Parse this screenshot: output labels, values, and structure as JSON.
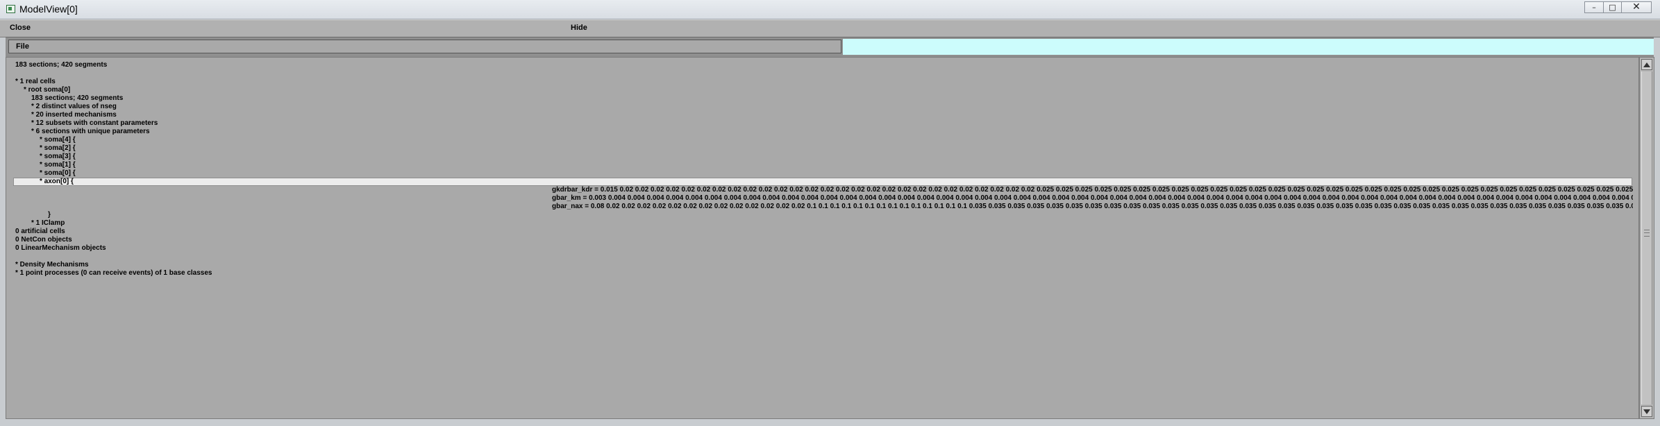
{
  "window": {
    "title": "ModelView[0]",
    "controls": {
      "minimize": "–",
      "maximize": "□",
      "close": "✕"
    }
  },
  "menubar": {
    "close_label": "Close",
    "hide_label": "Hide"
  },
  "filebar": {
    "file_label": "File"
  },
  "tree": {
    "summary": "183 sections; 420 segments",
    "real_cells": "* 1 real cells",
    "root": "* root soma[0]",
    "root_summary": "183 sections; 420 segments",
    "nseg": "* 2 distinct values of nseg",
    "mechanisms": "* 20 inserted mechanisms",
    "subsets": "* 12 subsets with constant parameters",
    "unique_sections": "* 6 sections with unique parameters",
    "sections": [
      "* soma[4] {",
      "* soma[2] {",
      "* soma[3] {",
      "* soma[1] {",
      "* soma[0] {",
      "* axon[0] {"
    ],
    "params": [
      "gkdrbar_kdr = 0.015 0.02 0.02 0.02 0.02 0.02 0.02 0.02 0.02 0.02 0.02 0.02 0.02 0.02 0.02 0.02 0.02 0.02 0.02 0.02 0.02 0.02 0.02 0.02 0.02 0.02 0.02 0.02 0.025 0.025 0.025 0.025 0.025 0.025 0.025 0.025 0.025 0.025 0.025 0.025 0.025 0.025 0.025 0.025 0.025 0.025 0.025 0.025 0.025 0.025 0.025 0.025 0.025 0.025 0.025 0.025 0.025 0.025 0.025 0.025 0.025 0.025 0.025 0.025 0.025 0.025 0",
      "gbar_km = 0.003 0.004 0.004 0.004 0.004 0.004 0.004 0.004 0.004 0.004 0.004 0.004 0.004 0.004 0.004 0.004 0.004 0.004 0.004 0.004 0.004 0.004 0.004 0.004 0.004 0.004 0.004 0.004 0.004 0.004 0.004 0.004 0.004 0.004 0.004 0.004 0.004 0.004 0.004 0.004 0.004 0.004 0.004 0.004 0.004 0.004 0.004 0.004 0.004 0.004 0.004 0.004 0.004 0.004 0.004 0.004 0.004 0.004 0.004 0.004 0.004 0.004 0.004 0.004 0.004 0.004 0.004 0",
      "gbar_nax = 0.08 0.02 0.02 0.02 0.02 0.02 0.02 0.02 0.02 0.02 0.02 0.02 0.02 0.02 0.1 0.1 0.1 0.1 0.1 0.1 0.1 0.1 0.1 0.1 0.1 0.1 0.1 0.1 0.035 0.035 0.035 0.035 0.035 0.035 0.035 0.035 0.035 0.035 0.035 0.035 0.035 0.035 0.035 0.035 0.035 0.035 0.035 0.035 0.035 0.035 0.035 0.035 0.035 0.035 0.035 0.035 0.035 0.035 0.035 0.035 0.035 0.035 0.035 0"
    ],
    "close_brace": "}",
    "iclamp": "* 1 IClamp",
    "artificial": "0 artificial cells",
    "netcon": "0 NetCon objects",
    "linear": "0 LinearMechanism objects",
    "density": "* Density Mechanisms",
    "point_processes": "* 1 point processes (0 can receive events) of 1 base classes"
  },
  "colors": {
    "pane_bg": "#a9a9a9",
    "cyan_area": "#ccfcfc",
    "highlight": "#ececec"
  }
}
